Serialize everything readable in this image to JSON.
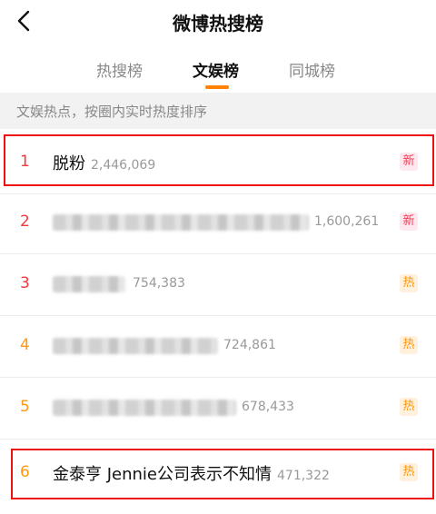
{
  "header": {
    "title": "微博热搜榜",
    "back_icon": "chevron-left-icon"
  },
  "tabs": [
    {
      "label": "热搜榜",
      "active": false
    },
    {
      "label": "文娱榜",
      "active": true
    },
    {
      "label": "同城榜",
      "active": false
    }
  ],
  "accent_color": "#ff8200",
  "subheader": "文娱热点，按圈内实时热度排序",
  "rows": [
    {
      "rank": "1",
      "title": "脱粉",
      "heat": "2,446,069",
      "badge": "新",
      "badge_type": "new",
      "blurred": false
    },
    {
      "rank": "2",
      "title": "",
      "heat": "1,600,261",
      "badge": "新",
      "badge_type": "new",
      "blurred": true
    },
    {
      "rank": "3",
      "title": "",
      "heat": "754,383",
      "badge": "热",
      "badge_type": "hot",
      "blurred": true
    },
    {
      "rank": "4",
      "title": "",
      "heat": "724,861",
      "badge": "热",
      "badge_type": "hot",
      "blurred": true
    },
    {
      "rank": "5",
      "title": "",
      "heat": "678,433",
      "badge": "热",
      "badge_type": "hot",
      "blurred": true
    },
    {
      "rank": "6",
      "title": "金泰亨 Jennie公司表示不知情",
      "heat": "471,322",
      "badge": "热",
      "badge_type": "hot",
      "blurred": false
    }
  ],
  "colors": {
    "rank_top": "#f4383c",
    "rank_other": "#ff9812",
    "highlight": "#ee1111"
  }
}
